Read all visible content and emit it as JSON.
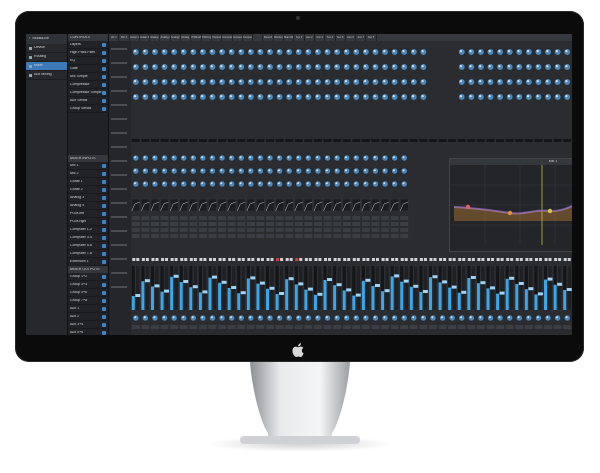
{
  "app": {
    "logo_text": "StudioLive",
    "nav": [
      {
        "label": "Device",
        "icon": "device-icon",
        "selected": false
      },
      {
        "label": "Routing",
        "icon": "routing-icon",
        "selected": false
      },
      {
        "label": "Mixer",
        "icon": "mixer-icon",
        "selected": true
      },
      {
        "label": "Aux Mixing",
        "icon": "aux-icon",
        "selected": false
      }
    ],
    "section_header": "CONTROLS",
    "controls": [
      "Layers",
      "High Pass Filter",
      "EQ",
      "Gate",
      "Mic Simple",
      "Compressor",
      "Compressor Simple",
      "Aux Sends",
      "Group Sends"
    ],
    "inputs_header": "MIXER INPUTS",
    "inputs": [
      "Mic 1",
      "Mic 2",
      "Guitar 1",
      "Guitar 2",
      "Analog 3",
      "Analog 4",
      "PGM-left",
      "PGM-right",
      "Computer 1-2",
      "Computer 3-4",
      "Computer 5-6",
      "Computer 7-8",
      "Extension 1"
    ],
    "outputs_header": "MIXER OUTPUTS",
    "outputs": [
      "Group 1+2",
      "Group 3+4",
      "Group 5+6",
      "Group 7+8",
      "Aux 1",
      "Aux 2",
      "Aux 3+4",
      "Aux 5+6",
      "Aux 7+8"
    ],
    "channels": [
      "Mic 1",
      "Mic 2",
      "Guitar 1",
      "Guitar 2",
      "Analog 3",
      "Analog 4",
      "Analog 5",
      "Analog 6",
      "PGM-left",
      "PGM-right",
      "Computer 1",
      "Computer 2",
      "Computer 3",
      "Computer 4",
      "",
      "Reverb",
      "Monitor",
      "Main Mix",
      "Aux 1",
      "Aux 2",
      "Aux 3",
      "Aux 4",
      "Aux 5",
      "Aux 6",
      "Aux 7",
      "Aux 8"
    ],
    "eq_title": "Mic 1",
    "colors": {
      "accent": "#3d79b8",
      "meter": "#3da6e6",
      "knob": "#6fa8d8",
      "eq_curve": "#e0913a"
    }
  }
}
